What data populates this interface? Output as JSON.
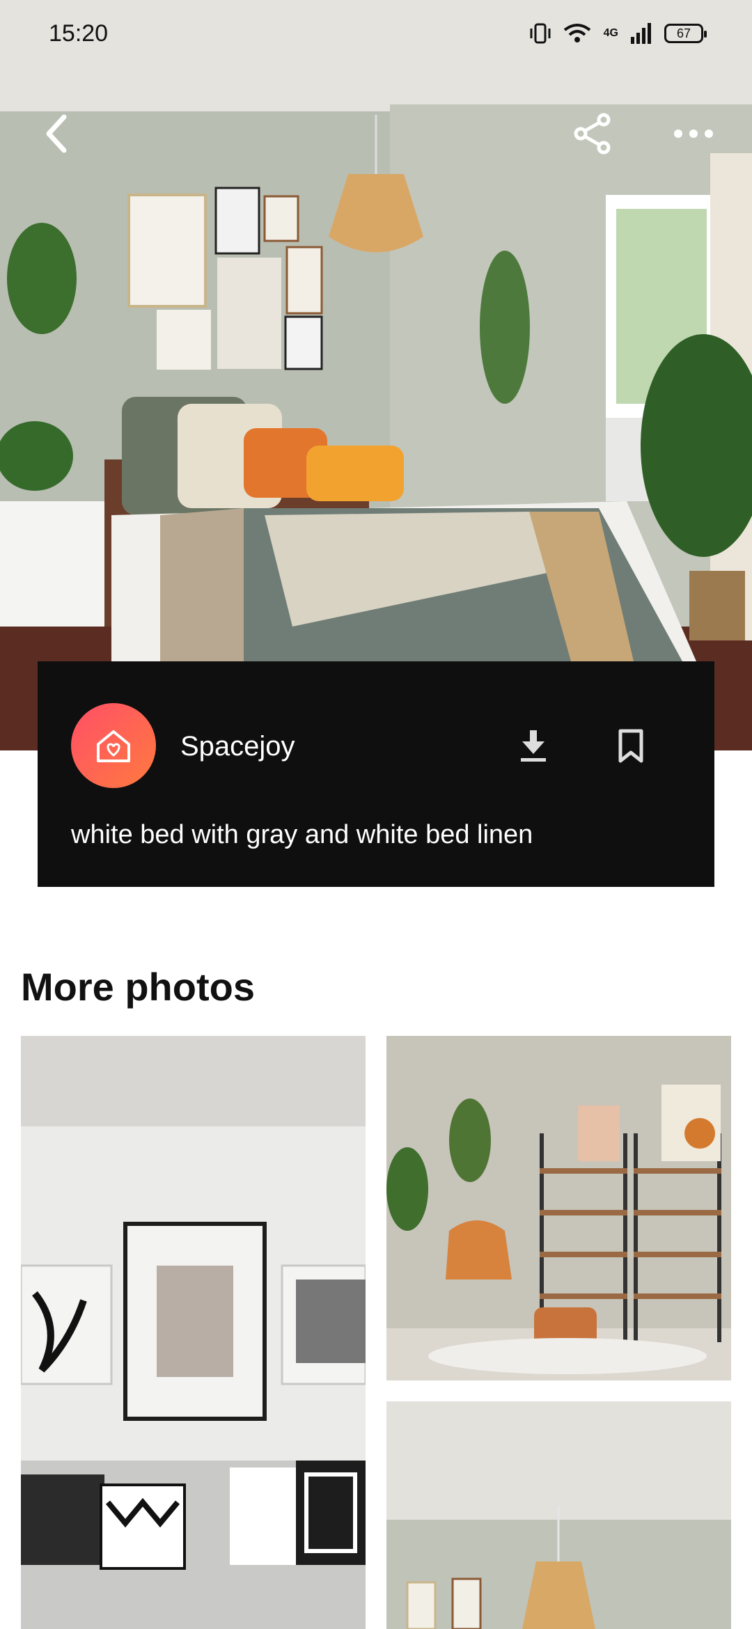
{
  "status_bar": {
    "time": "15:20",
    "network": "4G",
    "battery": "67",
    "icons": [
      "vibrate-icon",
      "wifi-icon",
      "signal-icon",
      "battery-icon"
    ]
  },
  "top_bar": {
    "back_icon": "back-chevron-icon",
    "share_icon": "share-icon",
    "more_icon": "more-dots-icon"
  },
  "photo": {
    "author": "Spacejoy",
    "description": "white bed with gray and white bed linen",
    "avatar_icon": "house-heart-icon",
    "download_icon": "download-icon",
    "bookmark_icon": "bookmark-icon",
    "avatar_gradient": [
      "#ff4f67",
      "#ff7a3f"
    ]
  },
  "more_photos": {
    "title": "More photos"
  }
}
